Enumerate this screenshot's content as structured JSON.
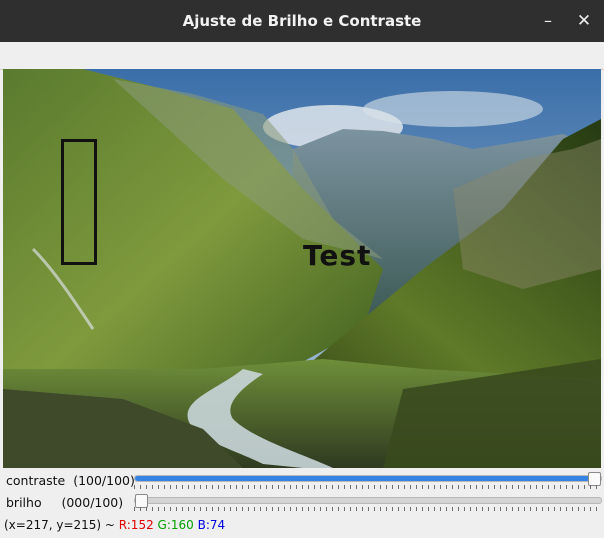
{
  "window": {
    "title": "Ajuste de Brilho e Contraste",
    "min_icon": "minimize-icon",
    "close_icon": "close-icon",
    "min_glyph": "–",
    "close_glyph": "✕"
  },
  "image": {
    "overlay_text": "Test"
  },
  "sliders": {
    "contrast": {
      "label": "contraste  (100/100)",
      "value": 100,
      "max": 100
    },
    "brightness": {
      "label": "brilho     (000/100)",
      "value": 0,
      "max": 100
    }
  },
  "status": {
    "coords": "(x=217, y=215) ~ ",
    "r": "R:152",
    "g": "G:160",
    "b": "B:74",
    "colors": {
      "r": "#e00000",
      "g": "#00a000",
      "b": "#0000e0"
    }
  }
}
